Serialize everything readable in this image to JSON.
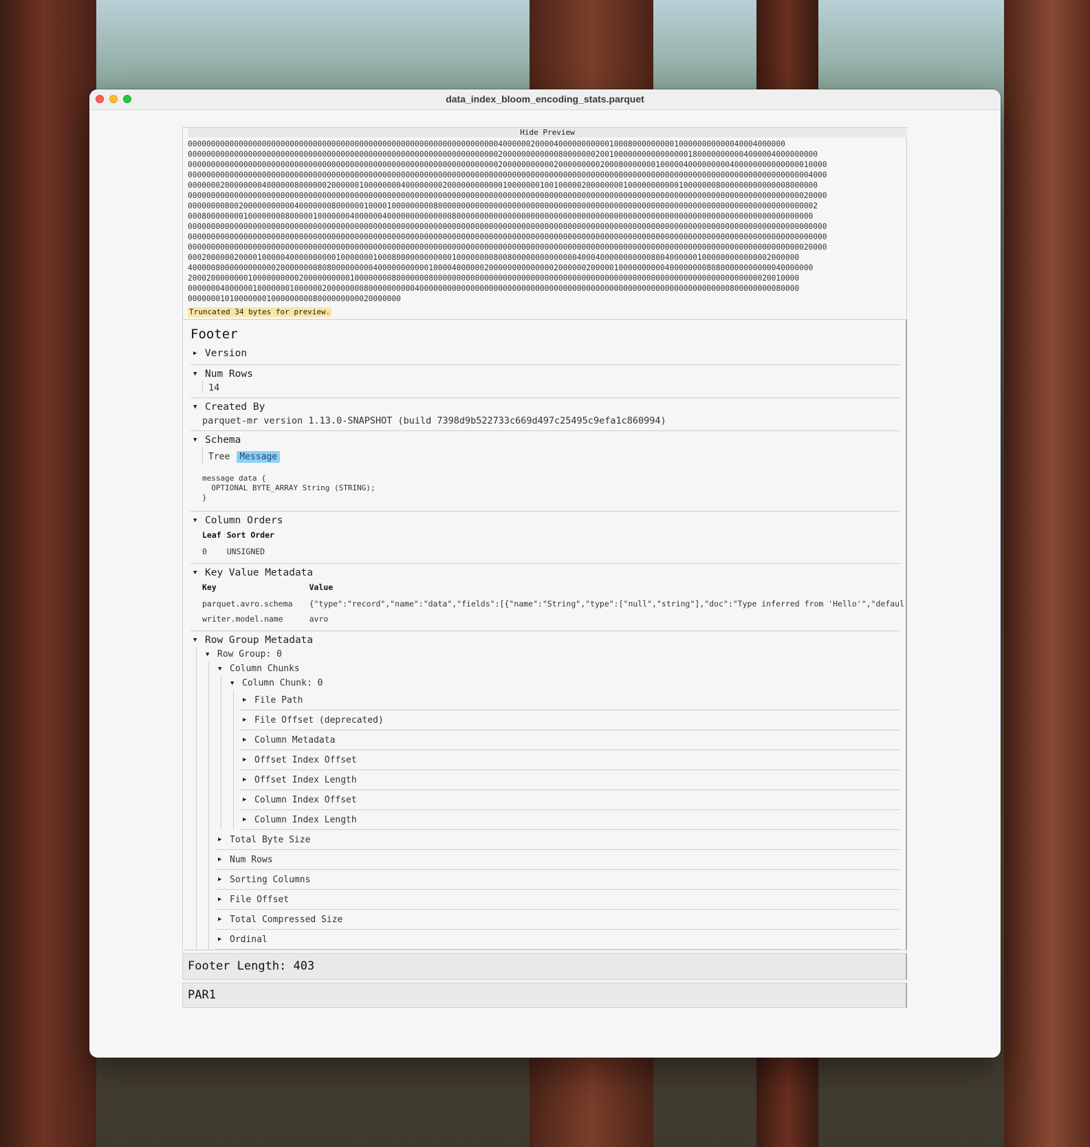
{
  "window": {
    "title": "data_index_bloom_encoding_stats.parquet"
  },
  "preview": {
    "hide_label": "Hide Preview",
    "hex_lines": [
      "000000000000000000000000000000000000000000000000000000000000000000040000002000040000000000010008000000000100000000000040004000000",
      "0000000000000000000000000000000000000000000000000000000000000000000200000000000080000000200100000000000000001800000000004000004000000000",
      "000000000000000000000000000000000000000000000000000000000000000000020000000000020000000002000800000001000004000000000400000000000000010000",
      "000000000000000000000000000000000000000000000000000000000000000000000000000000000000000000000000000000000000000000000000000000000000004000",
      "0000000200000000400000080000002000000100000000400000000200000000000010000000100100000200000000100000000000100000008000000000000008000000",
      "000000000000000000000000000000000000000000000000000000000000000000000000000000000000000000000000000000000000000000000000000000000000020000",
      "0000000080020000000000040000000800000010000100000000080000000000000000000000000000000000000000000000000000000000000000000000000000000002",
      "000800000000100000000800000100000004000000400000000000000800000000000000000000000000000000000000000000000000000000000000000000000000000",
      "000000000000000000000000000000000000000000000000000000000000000000000000000000000000000000000000000000000000000000000000000000000000000000",
      "000000000000000000000000000000000000000000000000000000000000000000000000000000000000000000000000000000000000000000000000000000000000000000",
      "000000000000000000000000000000000000000000000000000000000000000000000000000000000000000000000000000000000000000000000000000000000000020000",
      "000200000020000100000400000000001000000010008000000000000100000000800800000000000000400040000000000080040000001000000000000002000000",
      "400000800000000000020000000080800000000040000000000010000400000020000000000000020000002000001000000000040000000080800000000000040000000",
      "200020000000010000000000200000000001000000008000000080000000000000000000000000000000000000000000000000000000000000000000000020010000",
      "000000040000001000000010000002000000008000000000040000000000000000000000000000000000000000000000000000000000000000000800000000080000",
      "0000000101000000010000000008000000000020000000"
    ],
    "truncated_note": "Truncated 34 bytes for preview."
  },
  "footer": {
    "heading": "Footer",
    "version_label": "Version",
    "num_rows_label": "Num Rows",
    "num_rows_value": "14",
    "created_by_label": "Created By",
    "created_by_value": "parquet-mr version 1.13.0-SNAPSHOT (build 7398d9b522733c669d497c25495c9efa1c860994)",
    "schema_label": "Schema",
    "schema_tabs": {
      "tree": "Tree",
      "message": "Message"
    },
    "schema_message": "message data {\n  OPTIONAL BYTE_ARRAY String (STRING);\n}",
    "column_orders_label": "Column Orders",
    "column_orders_headers": {
      "leaf": "Leaf",
      "sort_order": "Sort Order"
    },
    "column_orders_rows": [
      {
        "leaf": "0",
        "sort_order": "UNSIGNED"
      }
    ],
    "kv_label": "Key Value Metadata",
    "kv_headers": {
      "key": "Key",
      "value": "Value"
    },
    "kv_rows": [
      {
        "key": "parquet.avro.schema",
        "value": "{\"type\":\"record\",\"name\":\"data\",\"fields\":[{\"name\":\"String\",\"type\":[\"null\",\"string\"],\"doc\":\"Type inferred from 'Hello'\",\"defaul"
      },
      {
        "key": "writer.model.name",
        "value": "avro"
      }
    ],
    "rg_label": "Row Group Metadata",
    "row_group_label": "Row Group: 0",
    "column_chunks_label": "Column Chunks",
    "column_chunk_label": "Column Chunk: 0",
    "chunk_fields": [
      "File Path",
      "File Offset (deprecated)",
      "Column Metadata",
      "Offset Index Offset",
      "Offset Index Length",
      "Column Index Offset",
      "Column Index Length"
    ],
    "row_group_fields": [
      "Total Byte Size",
      "Num Rows",
      "Sorting Columns",
      "File Offset",
      "Total Compressed Size",
      "Ordinal"
    ]
  },
  "footer_length": "Footer Length: 403",
  "magic": "PAR1",
  "icons": {
    "expanded": "▼",
    "collapsed": "▶"
  }
}
